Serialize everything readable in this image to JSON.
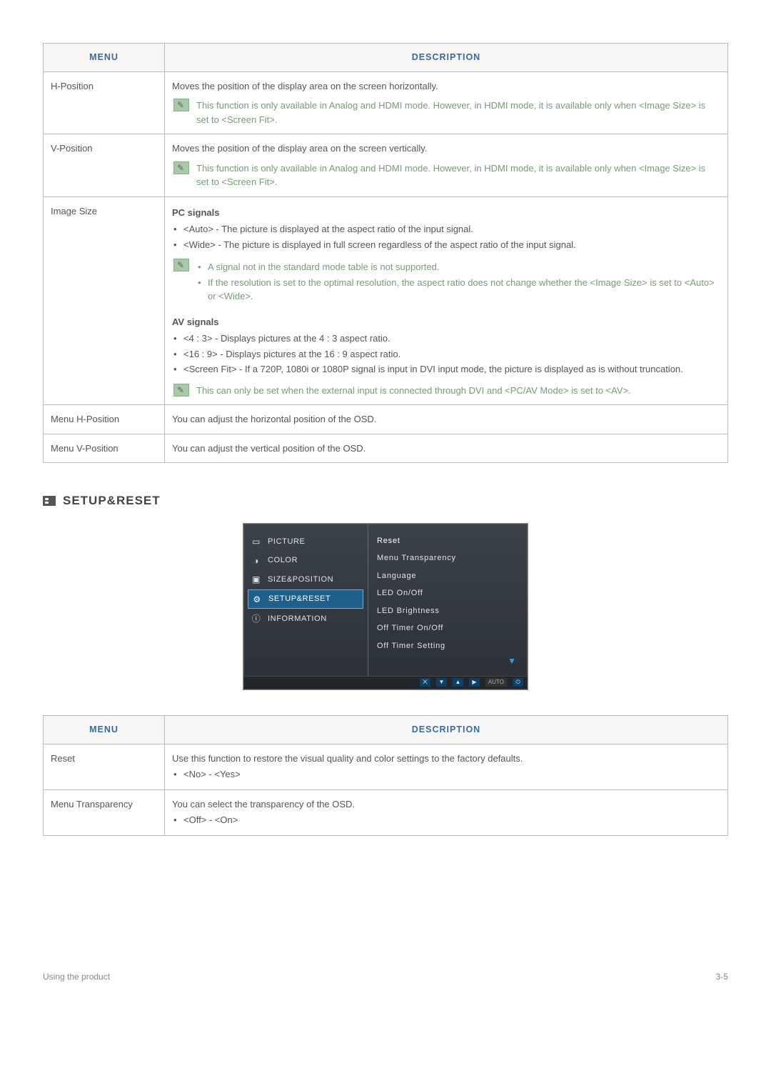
{
  "table1": {
    "header_menu": "MENU",
    "header_desc": "DESCRIPTION",
    "rows": {
      "r0": {
        "menu": "H-Position",
        "desc": "Moves the position of the display area on the screen horizontally.",
        "note": "This function is only available in Analog and HDMI mode. However, in HDMI mode, it is available only when <Image Size> is set to <Screen Fit>."
      },
      "r1": {
        "menu": "V-Position",
        "desc": "Moves the position of the display area on the screen vertically.",
        "note": "This function is only available in Analog and HDMI mode. However, in HDMI mode, it is available only when <Image Size> is set to <Screen Fit>."
      },
      "r2": {
        "menu": "Image Size",
        "pc_heading": "PC signals",
        "pc_b1": "<Auto> - The picture is displayed at the aspect ratio of the input signal.",
        "pc_b2": "<Wide> - The picture is displayed in full screen regardless of the aspect ratio of the input signal.",
        "note_b1": "A signal not in the standard mode table is not supported.",
        "note_b2": "If the resolution is set to the optimal resolution, the aspect ratio does not change whether the <Image Size> is set to <Auto> or <Wide>.",
        "av_heading": "AV signals",
        "av_b1": "<4 : 3> - Displays pictures at the 4 : 3 aspect ratio.",
        "av_b2": "<16 : 9> - Displays pictures at the 16 : 9 aspect ratio.",
        "av_b3": "<Screen Fit> - If a 720P, 1080i or 1080P signal is input in DVI input mode, the picture is displayed as is without truncation.",
        "note2": "This can only be set when the external input is connected through DVI and <PC/AV Mode> is set to <AV>."
      },
      "r3": {
        "menu": "Menu H-Position",
        "desc": "You can adjust the horizontal position of the OSD."
      },
      "r4": {
        "menu": "Menu V-Position",
        "desc": "You can adjust the vertical position of the OSD."
      }
    }
  },
  "section2_title": "SETUP&RESET",
  "osd": {
    "left": {
      "picture": "PICTURE",
      "color": "COLOR",
      "sizepos": "SIZE&POSITION",
      "setup": "SETUP&RESET",
      "info": "INFORMATION"
    },
    "right": {
      "reset": "Reset",
      "transparency": "Menu Transparency",
      "language": "Language",
      "led_onoff": "LED On/Off",
      "led_brightness": "LED Brightness",
      "off_timer_onoff": "Off Timer On/Off",
      "off_timer_setting": "Off Timer Setting"
    },
    "footer": {
      "auto": "AUTO"
    }
  },
  "table2": {
    "header_menu": "MENU",
    "header_desc": "DESCRIPTION",
    "rows": {
      "r0": {
        "menu": "Reset",
        "desc": "Use this function to restore the visual quality and color settings to the factory defaults.",
        "b1": "<No> - <Yes>"
      },
      "r1": {
        "menu": "Menu Transparency",
        "desc": "You can select the transparency of the OSD.",
        "b1": "<Off> - <On>"
      }
    }
  },
  "footer": {
    "left": "Using the product",
    "right": "3-5"
  }
}
